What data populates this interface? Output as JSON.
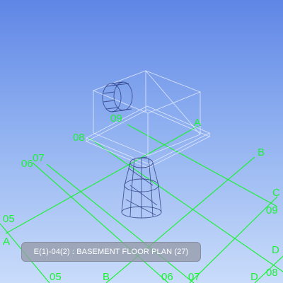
{
  "viewport": {
    "background_top": "#5f86e6",
    "background_bottom": "#c9dcfa",
    "grid_color": "#1ef03a",
    "view_tag": "E(1)-04(2) : BASEMENT FLOOR PLAN (27)"
  },
  "grid_labels": {
    "l09_top": "09",
    "l08_left": "08",
    "l07": "07",
    "l06": "06",
    "l05": "05",
    "lA_left": "A",
    "lA_top": "A",
    "lB_right": "B",
    "lC": "C",
    "l09_right": "09",
    "lD_right": "D",
    "l08_right": "08",
    "l05_bottom": "05",
    "lB_bottom": "B",
    "l06_bottom": "06",
    "l07_bottom": "07",
    "lD_bottom": "D"
  }
}
